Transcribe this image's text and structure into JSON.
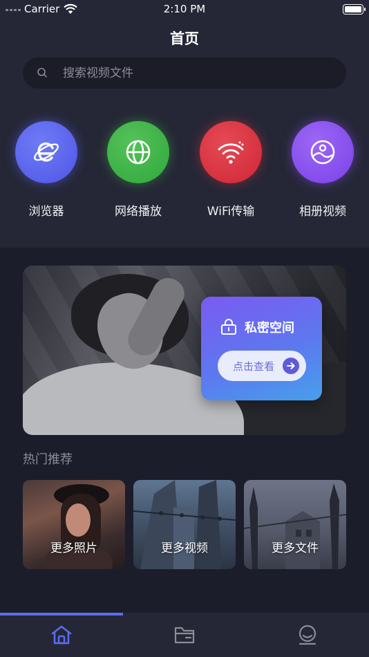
{
  "status_bar": {
    "carrier": "Carrier",
    "time": "2:10 PM"
  },
  "header": {
    "title": "首页"
  },
  "search": {
    "placeholder": "搜索视频文件"
  },
  "quick_actions": [
    {
      "label": "浏览器",
      "icon": "browser-e-icon",
      "color": "#5a62f0"
    },
    {
      "label": "网络播放",
      "icon": "globe-icon",
      "color": "#3fb247"
    },
    {
      "label": "WiFi传输",
      "icon": "wifi-icon",
      "color": "#d8323f"
    },
    {
      "label": "相册视频",
      "icon": "photo-icon",
      "color": "#8b4ff0"
    }
  ],
  "private_space": {
    "title": "私密空间",
    "button_label": "点击查看"
  },
  "hot": {
    "title": "热门推荐",
    "cards": [
      {
        "label": "更多照片"
      },
      {
        "label": "更多视频"
      },
      {
        "label": "更多文件"
      }
    ]
  },
  "tabbar": {
    "accent": "#5b6cf0",
    "tabs": [
      {
        "icon": "home-icon",
        "active": true
      },
      {
        "icon": "folder-icon",
        "active": false
      },
      {
        "icon": "profile-icon",
        "active": false
      }
    ]
  }
}
